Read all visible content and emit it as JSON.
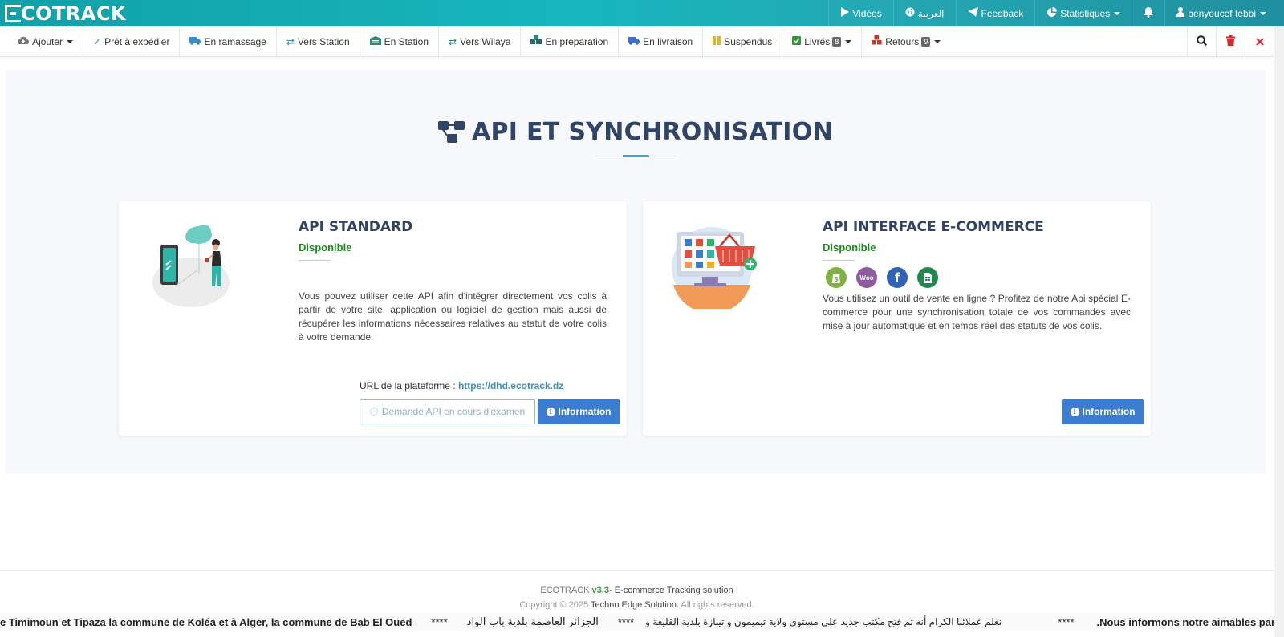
{
  "topbar": {
    "logo_text": "COTRACK",
    "items": [
      {
        "label": "Vidéos",
        "icon": "play-icon"
      },
      {
        "label": "العربية",
        "icon": "globe-icon"
      },
      {
        "label": "Feedback",
        "icon": "paper-plane-icon"
      },
      {
        "label": "Statistiques",
        "icon": "pie-chart-icon"
      },
      {
        "label": "",
        "icon": "bell-icon"
      },
      {
        "label": "benyoucef tebbi",
        "icon": "user-icon"
      }
    ]
  },
  "toolbar": {
    "items": [
      {
        "label": "Ajouter",
        "icon": "cloud-upload-icon",
        "color": "#666"
      },
      {
        "label": "Prêt à expédier",
        "icon": "check-icon",
        "color": "#3a8fc8"
      },
      {
        "label": "En ramassage",
        "icon": "truck-icon",
        "color": "#3a8fc8"
      },
      {
        "label": "Vers Station",
        "icon": "exchange-icon",
        "color": "#3a8fc8"
      },
      {
        "label": "En Station",
        "icon": "warehouse-icon",
        "color": "#2a8a7a"
      },
      {
        "label": "Vers Wilaya",
        "icon": "exchange-icon",
        "color": "#2a8a7a"
      },
      {
        "label": "En preparation",
        "icon": "boxes-icon",
        "color": "#2a6a6a"
      },
      {
        "label": "En livraison",
        "icon": "truck-icon",
        "color": "#3c6fd1"
      },
      {
        "label": "Suspendus",
        "icon": "pause-icon",
        "color": "#e8b21c"
      },
      {
        "label": "Livrés",
        "icon": "check-square-icon",
        "color": "#2a9a2a",
        "badge": "8"
      },
      {
        "label": "Retours",
        "icon": "cubes-icon",
        "color": "#c0392b",
        "badge": "9"
      }
    ],
    "right_icons": [
      "search-icon",
      "trash-icon",
      "close-icon"
    ]
  },
  "page": {
    "title": "API ET SYNCHRONISATION"
  },
  "cards": [
    {
      "title": "API STANDARD",
      "status": "Disponible",
      "description": "Vous pouvez utiliser cette API afin d'intégrer directement vos colis à partir de votre site, application ou logiciel de gestion mais aussi de récupérer les informations nécessaires relatives au statut de votre colis à votre demande.",
      "url_label": "URL de la plateforme : ",
      "url": "https://dhd.ecotrack.dz",
      "pending_button": "Demande API en cours d'examen",
      "info_button": "Information"
    },
    {
      "title": "API INTERFACE E-COMMERCE",
      "status": "Disponible",
      "platforms": [
        "shopify-icon",
        "woocommerce-icon",
        "facebook-icon",
        "google-sheets-icon"
      ],
      "description": "Vous utilisez un outil de vente en ligne ? Profitez de notre Api spécial E-commerce pour une synchronisation totale de vos commandes avec mise à jour automatique et en temps réel des statuts de vos colis.",
      "info_button": "Information"
    }
  ],
  "footer": {
    "brand": "ECOTRACK",
    "version": "v3.3",
    "tagline": "- E-commerce Tracking solution",
    "copyright_prefix": "Copyright © 2025",
    "company": "Techno Edge Solution.",
    "rights": "All rights reserved."
  },
  "ticker": {
    "segments": [
      "e Timimoun et Tipaza la commune de Koléa et à Alger, la commune de Bab El Oued",
      "****",
      "الجزائر العاصمة بلدية باب الواد",
      "****",
      "نعلم عملائنا الكرام أنه تم فتح مكتب جديد على مستوى ولاية تيميمون و تيبازة بلدية القليعة و",
      "****",
      ".Nous informons notre aimables parte"
    ]
  }
}
